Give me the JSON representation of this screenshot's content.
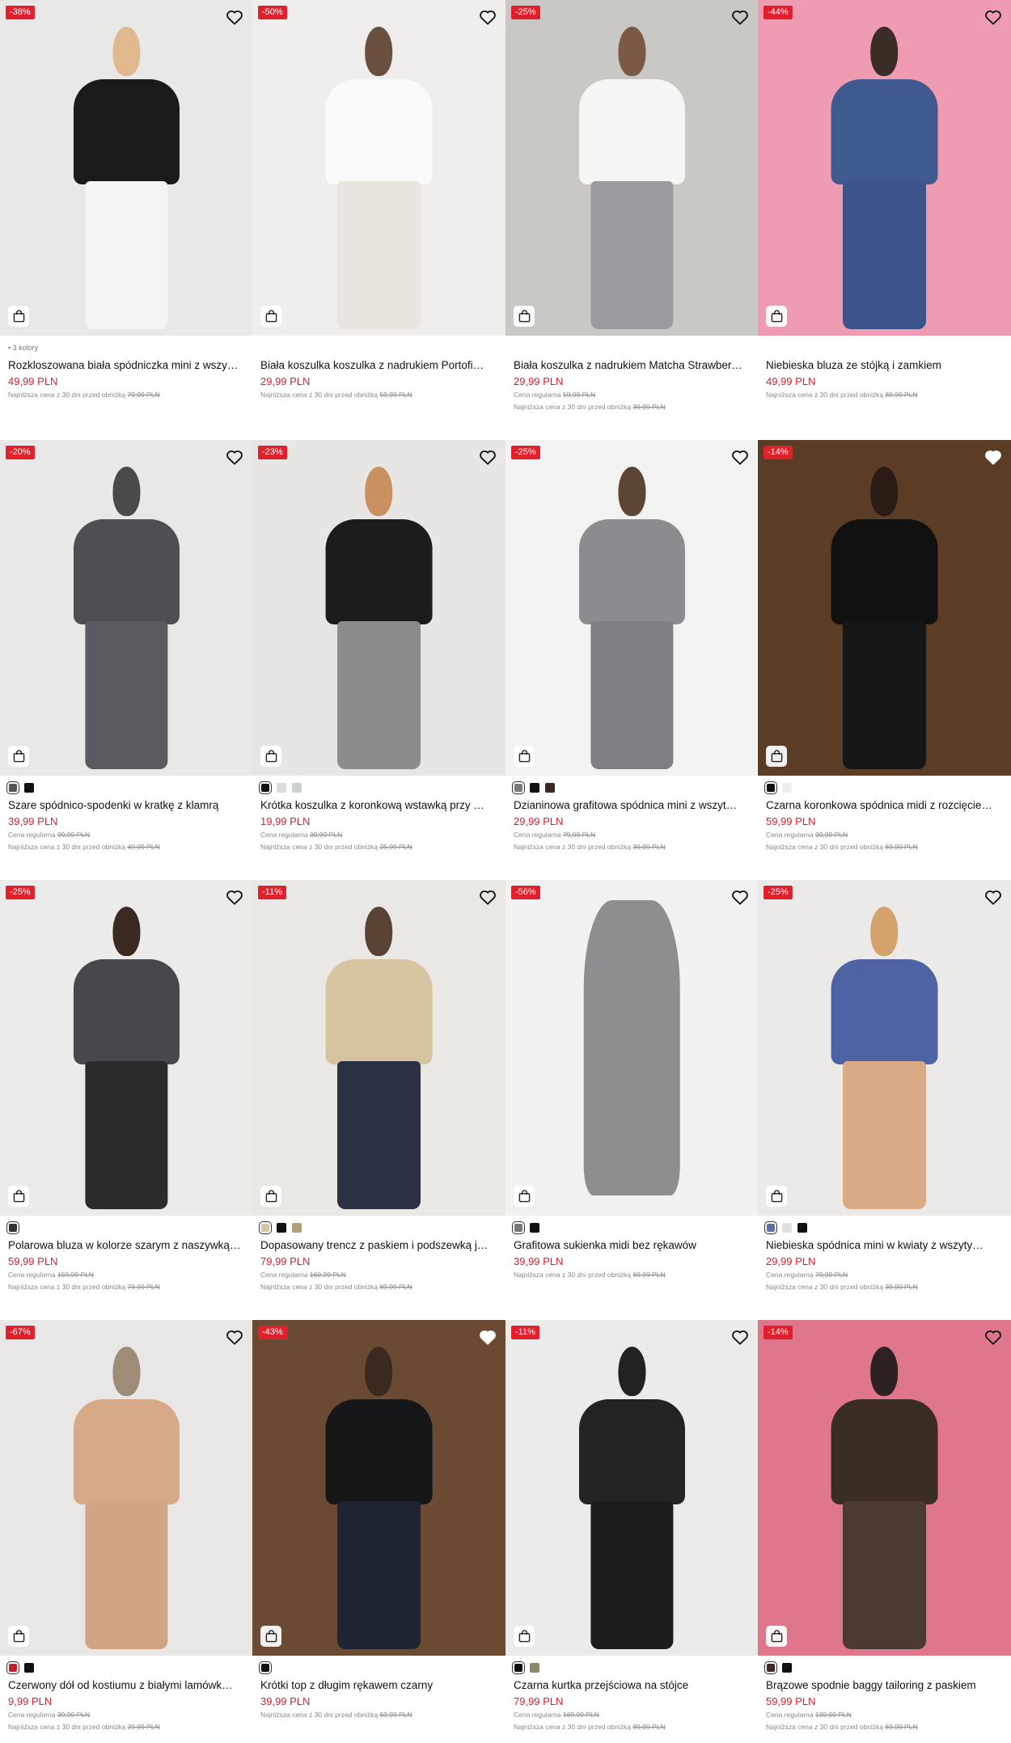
{
  "products": [
    {
      "badge": "-38%",
      "colors_text": "• 3 kolory",
      "swatches": [],
      "name": "Rozkloszowana biała spódniczka mini z wszy…",
      "price": "49,99 PLN",
      "regular_label": "",
      "regular_price": "",
      "lowest_label": "Najniższa cena z 30 dni przed obniżką",
      "lowest_price": "79,99 PLN",
      "bg": "#e9e8e6",
      "colors": {
        "head": "#e0b98e",
        "torso": "#1a1a1a",
        "lower": "#f4f4f2"
      },
      "wish_filled": false
    },
    {
      "badge": "-50%",
      "colors_text": "",
      "swatches": [],
      "name": "Biała koszulka koszulka z nadrukiem Portofi…",
      "price": "29,99 PLN",
      "regular_label": "",
      "regular_price": "",
      "lowest_label": "Najniższa cena z 30 dni przed obniżką",
      "lowest_price": "59,99 PLN",
      "bg": "#efeeec",
      "colors": {
        "head": "#6b5040",
        "torso": "#fafafa",
        "lower": "#e9e6e0"
      },
      "wish_filled": false
    },
    {
      "badge": "-25%",
      "colors_text": "",
      "swatches": [],
      "name": "Biała koszulka z nadrukiem Matcha Strawber…",
      "price": "29,99 PLN",
      "regular_label": "Cena regularna",
      "regular_price": "59,99 PLN",
      "lowest_label": "Najniższa cena z 30 dni przed obniżką",
      "lowest_price": "39,99 PLN",
      "bg": "#c9c8c5",
      "colors": {
        "head": "#7a5a44",
        "torso": "#f6f5f3",
        "lower": "#9a9b9e"
      },
      "wish_filled": false
    },
    {
      "badge": "-44%",
      "colors_text": "",
      "swatches": [],
      "name": "Niebieska bluza ze stójką i zamkiem",
      "price": "49,99 PLN",
      "regular_label": "",
      "regular_price": "",
      "lowest_label": "Najniższa cena z 30 dni przed obniżką",
      "lowest_price": "89,99 PLN",
      "bg": "#ef9bb1",
      "colors": {
        "head": "#3b2c25",
        "torso": "#3f5a8f",
        "lower": "#3b558a"
      },
      "wish_filled": false
    },
    {
      "badge": "-20%",
      "colors_text": "",
      "swatches": [
        "#555555",
        "#111111"
      ],
      "name": "Szare spódnico-spodenki w kratkę z klamrą",
      "price": "39,99 PLN",
      "regular_label": "Cena regularna",
      "regular_price": "99,99 PLN",
      "lowest_label": "Najniższa cena z 30 dni przed obniżką",
      "lowest_price": "49,99 PLN",
      "bg": "#e8e8e7",
      "colors": {
        "head": "#4a4a4a",
        "torso": "#4d4f53",
        "lower": "#5a5b60"
      },
      "wish_filled": false
    },
    {
      "badge": "-23%",
      "colors_text": "",
      "swatches": [
        "#111111",
        "#dcdcdc",
        "#c9d2d0"
      ],
      "name": "Krótka koszulka z koronkową wstawką przy …",
      "price": "19,99 PLN",
      "regular_label": "Cena regularna",
      "regular_price": "39,99 PLN",
      "lowest_label": "Najniższa cena z 30 dni przed obniżką",
      "lowest_price": "25,99 PLN",
      "bg": "#e7e6e4",
      "colors": {
        "head": "#c8915f",
        "torso": "#1c1c1c",
        "lower": "#8c8c8a"
      },
      "wish_filled": false
    },
    {
      "badge": "-25%",
      "colors_text": "",
      "swatches": [
        "#7b7b7b",
        "#111111",
        "#3a2a24"
      ],
      "name": "Dzianinowa grafitowa spódnica mini z wszyt…",
      "price": "29,99 PLN",
      "regular_label": "Cena regularna",
      "regular_price": "79,99 PLN",
      "lowest_label": "Najniższa cena z 30 dni przed obniżką",
      "lowest_price": "39,99 PLN",
      "bg": "#f2f2f1",
      "colors": {
        "head": "#5c4535",
        "torso": "#8a8c8f",
        "lower": "#7e8083"
      },
      "wish_filled": false
    },
    {
      "badge": "-14%",
      "colors_text": "",
      "swatches": [
        "#111111",
        "#eeeeee"
      ],
      "name": "Czarna koronkowa spódnica midi z rozcięcie…",
      "price": "59,99 PLN",
      "regular_label": "Cena regularna",
      "regular_price": "99,99 PLN",
      "lowest_label": "Najniższa cena z 30 dni przed obniżką",
      "lowest_price": "69,99 PLN",
      "bg": "#5b3d26",
      "colors": {
        "head": "#2a1c14",
        "torso": "#111111",
        "lower": "#161616"
      },
      "wish_filled": true
    },
    {
      "badge": "-25%",
      "colors_text": "",
      "swatches": [
        "#333333"
      ],
      "name": "Polarowa bluza w kolorze szarym z naszywką…",
      "price": "59,99 PLN",
      "regular_label": "Cena regularna",
      "regular_price": "159,99 PLN",
      "lowest_label": "Najniższa cena z 30 dni przed obniżką",
      "lowest_price": "79,99 PLN",
      "bg": "#ebebea",
      "colors": {
        "head": "#3a2a22",
        "torso": "#47484b",
        "lower": "#2b2b2d"
      },
      "wish_filled": false
    },
    {
      "badge": "-11%",
      "colors_text": "",
      "swatches": [
        "#d4c3a2",
        "#111111",
        "#b5a07a"
      ],
      "name": "Dopasowany trencz z paskiem i podszewką j…",
      "price": "79,99 PLN",
      "regular_label": "Cena regularna",
      "regular_price": "169,99 PLN",
      "lowest_label": "Najniższa cena z 30 dni przed obniżką",
      "lowest_price": "89,99 PLN",
      "bg": "#e9e8e5",
      "colors": {
        "head": "#5a4334",
        "torso": "#d6c4a1",
        "lower": "#2a3140"
      },
      "wish_filled": false
    },
    {
      "badge": "-56%",
      "colors_text": "",
      "swatches": [
        "#777777",
        "#111111"
      ],
      "name": "Grafitowa sukienka midi bez rękawów",
      "price": "39,99 PLN",
      "regular_label": "",
      "regular_price": "",
      "lowest_label": "Najniższa cena z 30 dni przed obniżką",
      "lowest_price": "89,99 PLN",
      "bg": "#f1f1f0",
      "colors": {
        "head": "#f1f1f0",
        "torso": "#8d8e90",
        "lower": "#8a8b8d"
      },
      "wish_filled": false,
      "flatlay": true
    },
    {
      "badge": "-25%",
      "colors_text": "",
      "swatches": [
        "#5a6fa8",
        "#e0e0e0",
        "#111111"
      ],
      "name": "Niebieska spódnica mini w kwiaty z wszyty…",
      "price": "29,99 PLN",
      "regular_label": "Cena regularna",
      "regular_price": "79,99 PLN",
      "lowest_label": "Najniższa cena z 30 dni przed obniżką",
      "lowest_price": "39,99 PLN",
      "bg": "#ebeae8",
      "colors": {
        "head": "#d4a36d",
        "torso": "#4d63a4",
        "lower": "#d8ab86"
      },
      "wish_filled": false
    },
    {
      "badge": "-67%",
      "colors_text": "",
      "swatches": [
        "#c8202a",
        "#111111"
      ],
      "name": "Czerwony dół od kostiumu z białymi lamówk…",
      "price": "9,99 PLN",
      "regular_label": "Cena regularna",
      "regular_price": "39,99 PLN",
      "lowest_label": "Najniższa cena z 30 dni przed obniżką",
      "lowest_price": "29,99 PLN",
      "bg": "#e8e7e5",
      "colors": {
        "head": "#9d8d78",
        "torso": "#d6a989",
        "lower": "#d2a486"
      },
      "wish_filled": false
    },
    {
      "badge": "-43%",
      "colors_text": "",
      "swatches": [
        "#111111"
      ],
      "name": "Krótki top z długim rękawem czarny",
      "price": "39,99 PLN",
      "regular_label": "",
      "regular_price": "",
      "lowest_label": "Najniższa cena z 30 dni przed obniżką",
      "lowest_price": "69,99 PLN",
      "bg": "#6a4a33",
      "colors": {
        "head": "#3b2a20",
        "torso": "#161719",
        "lower": "#1e2530"
      },
      "wish_filled": true
    },
    {
      "badge": "-11%",
      "colors_text": "",
      "swatches": [
        "#111111",
        "#8b8a66"
      ],
      "name": "Czarna kurtka przejściowa na stójce",
      "price": "79,99 PLN",
      "regular_label": "Cena regularna",
      "regular_price": "169,99 PLN",
      "lowest_label": "Najniższa cena z 30 dni przed obniżką",
      "lowest_price": "89,99 PLN",
      "bg": "#ebebea",
      "colors": {
        "head": "#232121",
        "torso": "#242222",
        "lower": "#1c1c1c"
      },
      "wish_filled": false
    },
    {
      "badge": "-14%",
      "colors_text": "",
      "swatches": [
        "#3e2b24",
        "#111111"
      ],
      "name": "Brązowe spodnie baggy tailoring z paskiem",
      "price": "59,99 PLN",
      "regular_label": "Cena regularna",
      "regular_price": "139,99 PLN",
      "lowest_label": "Najniższa cena z 30 dni przed obniżką",
      "lowest_price": "69,99 PLN",
      "bg": "#e0768c",
      "colors": {
        "head": "#2d2220",
        "torso": "#3b2c26",
        "lower": "#4a3a33"
      },
      "wish_filled": false
    }
  ],
  "icons": {
    "wishlist": "heart-icon",
    "bag": "shopping-bag-icon"
  },
  "accent_price_color": "#d8202d",
  "badge_color": "#e0202c"
}
